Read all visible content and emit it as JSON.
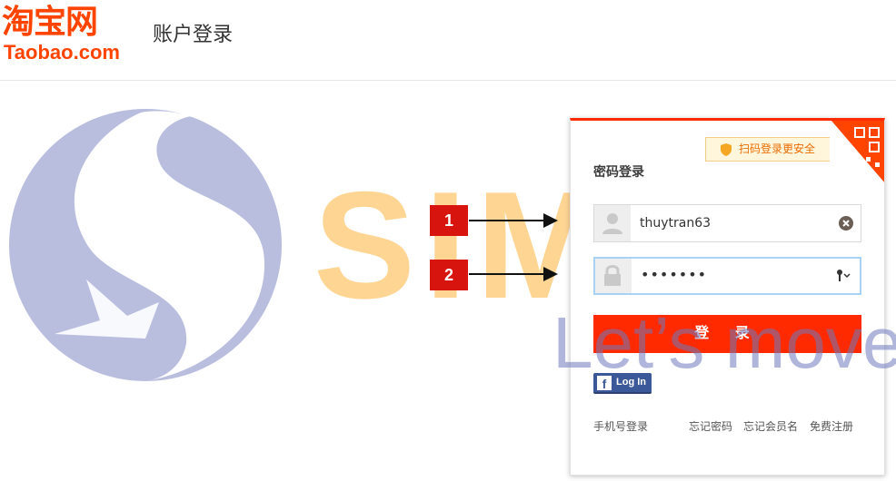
{
  "header": {
    "logo_cn": "淘宝网",
    "logo_en": "Taobao.com",
    "page_title": "账户登录"
  },
  "watermark": {
    "brand": "SIMBA",
    "slogan": "Let’s move"
  },
  "login": {
    "qr_tip": "扫码登录更安全",
    "title": "密码登录",
    "username_value": "thuytran63",
    "password_value": "•••••••",
    "submit_label": "登 录",
    "facebook_label": "Log In",
    "links": {
      "phone_login": "手机号登录",
      "forgot_password": "忘记密码",
      "forgot_member": "忘记会员名",
      "register": "免费注册"
    }
  },
  "annotations": {
    "step1": "1",
    "step2": "2"
  },
  "colors": {
    "brand_orange": "#ff4400",
    "submit_red": "#ff2a00",
    "marker_red": "#d8140e",
    "facebook_blue": "#3b5998"
  },
  "icons": [
    "user-icon",
    "lock-icon",
    "clear-icon",
    "key-icon",
    "shield-icon",
    "qr-code-icon",
    "facebook-icon"
  ]
}
